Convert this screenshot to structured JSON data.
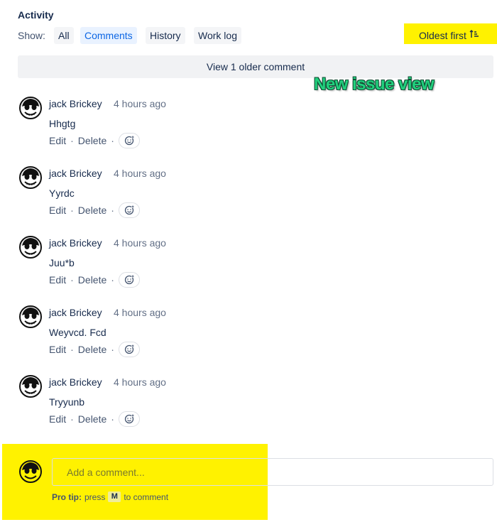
{
  "activity": {
    "title": "Activity",
    "show_label": "Show:",
    "filters": [
      {
        "label": "All",
        "selected": false
      },
      {
        "label": "Comments",
        "selected": true
      },
      {
        "label": "History",
        "selected": false
      },
      {
        "label": "Work log",
        "selected": false
      }
    ],
    "sort_label": "Oldest first",
    "sort_icon": "sort-ascending-icon",
    "older_comments_label": "View 1 older comment",
    "badge_text": "New issue view"
  },
  "comments": [
    {
      "author": "jack Brickey",
      "time": "4 hours ago",
      "body": "Hhgtg",
      "edit": "Edit",
      "delete": "Delete"
    },
    {
      "author": "jack Brickey",
      "time": "4 hours ago",
      "body": "Yyrdc",
      "edit": "Edit",
      "delete": "Delete"
    },
    {
      "author": "jack Brickey",
      "time": "4 hours ago",
      "body": "Juu*b",
      "edit": "Edit",
      "delete": "Delete"
    },
    {
      "author": "jack Brickey",
      "time": "4 hours ago",
      "body": "Weyvcd. Fcd",
      "edit": "Edit",
      "delete": "Delete"
    },
    {
      "author": "jack Brickey",
      "time": "4 hours ago",
      "body": "Tryyunb",
      "edit": "Edit",
      "delete": "Delete"
    }
  ],
  "composer": {
    "placeholder": "Add a comment...",
    "tip_bold": "Pro tip:",
    "tip_press": "press",
    "tip_key": "M",
    "tip_suffix": "to comment"
  },
  "colors": {
    "highlight": "#fff200",
    "selected_filter_text": "#0c66e4",
    "selected_filter_bg": "#e9f2ff",
    "badge": "#21d07d"
  }
}
